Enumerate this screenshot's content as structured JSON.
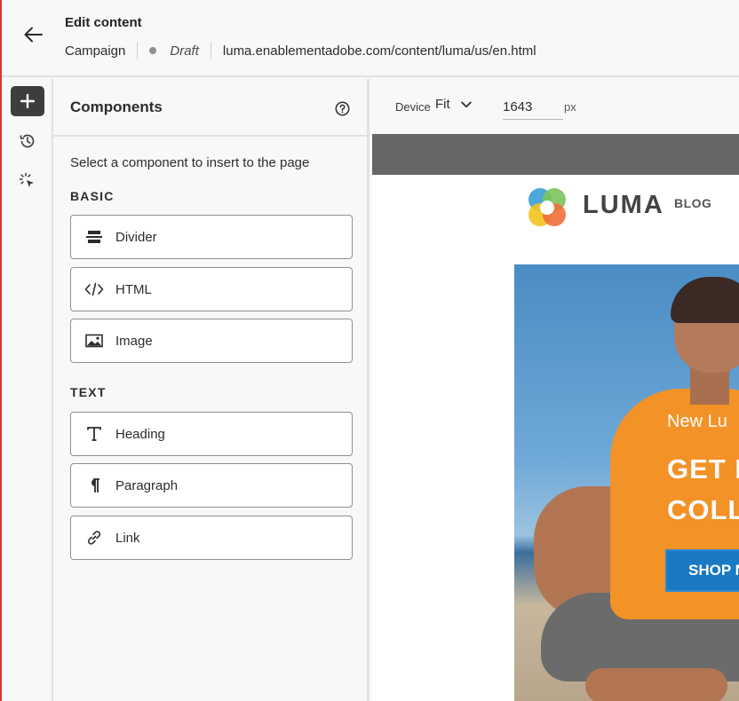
{
  "header": {
    "title": "Edit content",
    "channel": "Campaign",
    "status": "Draft",
    "url": "luma.enablementadobe.com/content/luma/us/en.html"
  },
  "rail": {
    "items": [
      {
        "name": "add",
        "icon": "plus-icon",
        "active": true
      },
      {
        "name": "history",
        "icon": "history-icon",
        "active": false
      },
      {
        "name": "select",
        "icon": "select-cursor-icon",
        "active": false
      }
    ]
  },
  "panel": {
    "title": "Components",
    "subtitle": "Select a component to insert to the page",
    "sections": [
      {
        "label": "BASIC",
        "items": [
          {
            "label": "Divider",
            "icon": "divider-icon"
          },
          {
            "label": "HTML",
            "icon": "code-icon"
          },
          {
            "label": "Image",
            "icon": "image-icon"
          }
        ]
      },
      {
        "label": "TEXT",
        "items": [
          {
            "label": "Heading",
            "icon": "heading-icon"
          },
          {
            "label": "Paragraph",
            "icon": "paragraph-icon"
          },
          {
            "label": "Link",
            "icon": "link-icon"
          }
        ]
      }
    ]
  },
  "toolbar": {
    "device_label": "Device",
    "device_value": "Fit",
    "width_value": "1643",
    "width_unit": "px"
  },
  "preview": {
    "logo_word": "LUMA",
    "logo_sub": "BLOG",
    "hero_kicker": "New Lu",
    "hero_title_line1": "GET I",
    "hero_title_line2": "COLL",
    "hero_cta": "SHOP N"
  },
  "colors": {
    "accent_red": "#d9362f",
    "cta_blue": "#1979c3",
    "shirt_orange": "#f39226"
  }
}
